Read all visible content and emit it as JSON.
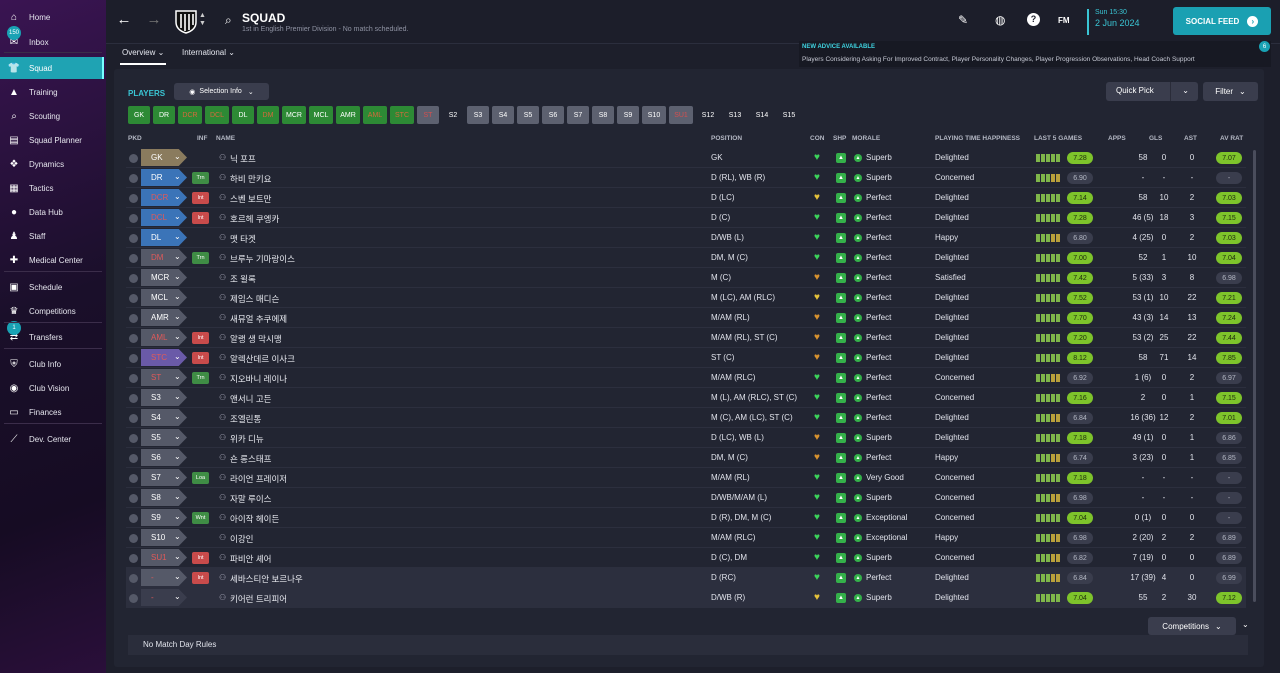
{
  "sidebar": {
    "items": [
      {
        "label": "Home",
        "icon": "home-icon",
        "glyph": "⌂"
      },
      {
        "label": "Inbox",
        "icon": "inbox-icon",
        "glyph": "✉",
        "badge": "150"
      },
      {
        "label": "Squad",
        "icon": "squad-icon",
        "glyph": "👕",
        "active": true
      },
      {
        "label": "Training",
        "icon": "training-icon",
        "glyph": "▲"
      },
      {
        "label": "Scouting",
        "icon": "scouting-icon",
        "glyph": "⌕"
      },
      {
        "label": "Squad Planner",
        "icon": "squad-planner-icon",
        "glyph": "▤"
      },
      {
        "label": "Dynamics",
        "icon": "dynamics-icon",
        "glyph": "❖"
      },
      {
        "label": "Tactics",
        "icon": "tactics-icon",
        "glyph": "▦"
      },
      {
        "label": "Data Hub",
        "icon": "data-hub-icon",
        "glyph": "●"
      },
      {
        "label": "Staff",
        "icon": "staff-icon",
        "glyph": "♟"
      },
      {
        "label": "Medical Center",
        "icon": "medical-icon",
        "glyph": "✚"
      },
      {
        "label": "Schedule",
        "icon": "schedule-icon",
        "glyph": "▣"
      },
      {
        "label": "Competitions",
        "icon": "trophy-icon",
        "glyph": "♛"
      },
      {
        "label": "Transfers",
        "icon": "transfers-icon",
        "glyph": "⇄",
        "badge": "1"
      },
      {
        "label": "Club Info",
        "icon": "club-info-icon",
        "glyph": "⛨"
      },
      {
        "label": "Club Vision",
        "icon": "club-vision-icon",
        "glyph": "◉"
      },
      {
        "label": "Finances",
        "icon": "finances-icon",
        "glyph": "▭"
      },
      {
        "label": "Dev. Center",
        "icon": "dev-center-icon",
        "glyph": "⟋"
      }
    ]
  },
  "header": {
    "title": "SQUAD",
    "subtitle": "1st in English Premier Division - No match scheduled.",
    "date_time": "Sun 15:30",
    "date_day": "2 Jun 2024",
    "fm_label": "FM",
    "social_label": "SOCIAL FEED",
    "social_badge": "6"
  },
  "tabs": {
    "overview": "Overview",
    "international": "International"
  },
  "advice": {
    "title": "NEW ADVICE AVAILABLE",
    "text": "Players Considering Asking For Improved Contract, Player Personality Changes, Player Progression Observations, Head Coach Support"
  },
  "toolbar": {
    "players_label": "PLAYERS",
    "selection_info": "Selection Info",
    "quick_pick": "Quick Pick",
    "filter": "Filter"
  },
  "chips": [
    {
      "label": "GK",
      "style": "g"
    },
    {
      "label": "DR",
      "style": "g"
    },
    {
      "label": "DCR",
      "style": "r"
    },
    {
      "label": "DCL",
      "style": "r"
    },
    {
      "label": "DL",
      "style": "g"
    },
    {
      "label": "DM",
      "style": "r"
    },
    {
      "label": "MCR",
      "style": "g"
    },
    {
      "label": "MCL",
      "style": "g"
    },
    {
      "label": "AMR",
      "style": "g"
    },
    {
      "label": "AML",
      "style": "r"
    },
    {
      "label": "STC",
      "style": "r"
    },
    {
      "label": "ST",
      "style": "gr"
    },
    {
      "label": "S2",
      "style": "k"
    },
    {
      "label": "S3",
      "style": "s"
    },
    {
      "label": "S4",
      "style": "s"
    },
    {
      "label": "S5",
      "style": "s"
    },
    {
      "label": "S6",
      "style": "s"
    },
    {
      "label": "S7",
      "style": "s"
    },
    {
      "label": "S8",
      "style": "s"
    },
    {
      "label": "S9",
      "style": "s"
    },
    {
      "label": "S10",
      "style": "s"
    },
    {
      "label": "SU1",
      "style": "gr"
    },
    {
      "label": "S12",
      "style": "k"
    },
    {
      "label": "S13",
      "style": "k"
    },
    {
      "label": "S14",
      "style": "k"
    },
    {
      "label": "S15",
      "style": "k"
    }
  ],
  "columns": {
    "pkd": "PKD",
    "inf": "INF",
    "name": "NAME",
    "position": "POSITION",
    "con": "CON",
    "shp": "SHP",
    "morale": "MORALE",
    "happiness": "PLAYING TIME HAPPINESS",
    "last5": "LAST 5 GAMES",
    "apps": "APPS",
    "gls": "GLS",
    "ast": "AST",
    "avrat": "AV RAT"
  },
  "colors": {
    "pos_gk": "#8a7b5e",
    "pos_def": "#3b74b8",
    "pos_mid": "#555968",
    "pos_red": "#c84b4b"
  },
  "players": [
    {
      "pos": "GK",
      "pc": "gk",
      "inf": "",
      "name": "닉 포프",
      "position": "GK",
      "con": "green",
      "morale": "Superb",
      "happy": "Delighted",
      "last5": "7.28",
      "l5g": true,
      "apps": "58",
      "gls": "0",
      "ast": "0",
      "avr": "7.07",
      "ag": true
    },
    {
      "pos": "DR",
      "pc": "def",
      "inf": "Trn",
      "name": "하비 만키요",
      "position": "D (RL), WB (R)",
      "con": "green",
      "morale": "Superb",
      "happy": "Concerned",
      "last5": "6.90",
      "l5g": false,
      "apps": "-",
      "gls": "-",
      "ast": "-",
      "avr": "-",
      "ag": false
    },
    {
      "pos": "DCR",
      "pc": "defr",
      "inf": "Int",
      "name": "스벤 보트만",
      "position": "D (LC)",
      "con": "yellow",
      "morale": "Perfect",
      "happy": "Delighted",
      "last5": "7.14",
      "l5g": true,
      "apps": "58",
      "gls": "10",
      "ast": "2",
      "avr": "7.03",
      "ag": true
    },
    {
      "pos": "DCL",
      "pc": "defr",
      "inf": "Int",
      "name": "호르헤 쿠엥카",
      "position": "D (C)",
      "con": "green",
      "morale": "Perfect",
      "happy": "Delighted",
      "last5": "7.28",
      "l5g": true,
      "apps": "46 (5)",
      "gls": "18",
      "ast": "3",
      "avr": "7.15",
      "ag": true
    },
    {
      "pos": "DL",
      "pc": "def",
      "inf": "",
      "name": "맷 타겟",
      "position": "D/WB (L)",
      "con": "green",
      "morale": "Perfect",
      "happy": "Happy",
      "last5": "6.80",
      "l5g": false,
      "apps": "4 (25)",
      "gls": "0",
      "ast": "2",
      "avr": "7.03",
      "ag": true
    },
    {
      "pos": "DM",
      "pc": "midr",
      "inf": "Trn",
      "name": "브루누 기마랑이스",
      "position": "DM, M (C)",
      "con": "green",
      "morale": "Perfect",
      "happy": "Delighted",
      "last5": "7.00",
      "l5g": true,
      "apps": "52",
      "gls": "1",
      "ast": "10",
      "avr": "7.04",
      "ag": true
    },
    {
      "pos": "MCR",
      "pc": "mid",
      "inf": "",
      "name": "조 윌록",
      "position": "M (C)",
      "con": "orange",
      "morale": "Perfect",
      "happy": "Satisfied",
      "last5": "7.42",
      "l5g": true,
      "apps": "5 (33)",
      "gls": "3",
      "ast": "8",
      "avr": "6.98",
      "ag": false
    },
    {
      "pos": "MCL",
      "pc": "mid",
      "inf": "",
      "name": "제임스 매디슨",
      "position": "M (LC), AM (RLC)",
      "con": "yellow",
      "morale": "Perfect",
      "happy": "Delighted",
      "last5": "7.52",
      "l5g": true,
      "apps": "53 (1)",
      "gls": "10",
      "ast": "22",
      "avr": "7.21",
      "ag": true
    },
    {
      "pos": "AMR",
      "pc": "mid",
      "inf": "",
      "name": "새뮤얼 추쿠에제",
      "position": "M/AM (RL)",
      "con": "orange",
      "morale": "Perfect",
      "happy": "Delighted",
      "last5": "7.70",
      "l5g": true,
      "apps": "43 (3)",
      "gls": "14",
      "ast": "13",
      "avr": "7.24",
      "ag": true
    },
    {
      "pos": "AML",
      "pc": "midr",
      "inf": "Int",
      "name": "알랭 생 막시맹",
      "position": "M/AM (RL), ST (C)",
      "con": "orange",
      "morale": "Perfect",
      "happy": "Delighted",
      "last5": "7.20",
      "l5g": true,
      "apps": "53 (2)",
      "gls": "25",
      "ast": "22",
      "avr": "7.44",
      "ag": true
    },
    {
      "pos": "STC",
      "pc": "str",
      "inf": "Int",
      "name": "알렉산데르 이사크",
      "position": "ST (C)",
      "con": "orange",
      "morale": "Perfect",
      "happy": "Delighted",
      "last5": "8.12",
      "l5g": true,
      "apps": "58",
      "gls": "71",
      "ast": "14",
      "avr": "7.85",
      "ag": true
    },
    {
      "pos": "ST",
      "pc": "midr",
      "inf": "Trn",
      "name": "지오바니 레이나",
      "position": "M/AM (RLC)",
      "con": "green",
      "morale": "Perfect",
      "happy": "Concerned",
      "last5": "6.92",
      "l5g": false,
      "apps": "1 (6)",
      "gls": "0",
      "ast": "2",
      "avr": "6.97",
      "ag": false
    },
    {
      "pos": "S3",
      "pc": "mid",
      "inf": "",
      "name": "앤서니 고든",
      "position": "M (L), AM (RLC), ST (C)",
      "con": "green",
      "morale": "Perfect",
      "happy": "Concerned",
      "last5": "7.16",
      "l5g": true,
      "apps": "2",
      "gls": "0",
      "ast": "1",
      "avr": "7.15",
      "ag": true
    },
    {
      "pos": "S4",
      "pc": "mid",
      "inf": "",
      "name": "조엘린통",
      "position": "M (C), AM (LC), ST (C)",
      "con": "green",
      "morale": "Perfect",
      "happy": "Delighted",
      "last5": "6.84",
      "l5g": false,
      "apps": "16 (36)",
      "gls": "12",
      "ast": "2",
      "avr": "7.01",
      "ag": true
    },
    {
      "pos": "S5",
      "pc": "mid",
      "inf": "",
      "name": "위카 디뉴",
      "position": "D (LC), WB (L)",
      "con": "orange",
      "morale": "Superb",
      "happy": "Delighted",
      "last5": "7.18",
      "l5g": true,
      "apps": "49 (1)",
      "gls": "0",
      "ast": "1",
      "avr": "6.86",
      "ag": false
    },
    {
      "pos": "S6",
      "pc": "mid",
      "inf": "",
      "name": "숀 롱스태프",
      "position": "DM, M (C)",
      "con": "orange",
      "morale": "Perfect",
      "happy": "Happy",
      "last5": "6.74",
      "l5g": false,
      "apps": "3 (23)",
      "gls": "0",
      "ast": "1",
      "avr": "6.85",
      "ag": false
    },
    {
      "pos": "S7",
      "pc": "mid",
      "inf": "Loa",
      "name": "라이언 프레이저",
      "position": "M/AM (RL)",
      "con": "green",
      "morale": "Very Good",
      "happy": "Concerned",
      "last5": "7.18",
      "l5g": true,
      "apps": "-",
      "gls": "-",
      "ast": "-",
      "avr": "-",
      "ag": false
    },
    {
      "pos": "S8",
      "pc": "mid",
      "inf": "",
      "name": "자말 루이스",
      "position": "D/WB/M/AM (L)",
      "con": "green",
      "morale": "Superb",
      "happy": "Concerned",
      "last5": "6.98",
      "l5g": false,
      "apps": "-",
      "gls": "-",
      "ast": "-",
      "avr": "-",
      "ag": false
    },
    {
      "pos": "S9",
      "pc": "mid",
      "inf": "Wnt",
      "name": "아이작 헤이든",
      "position": "D (R), DM, M (C)",
      "con": "green",
      "morale": "Exceptional",
      "happy": "Concerned",
      "last5": "7.04",
      "l5g": true,
      "apps": "0 (1)",
      "gls": "0",
      "ast": "0",
      "avr": "-",
      "ag": false
    },
    {
      "pos": "S10",
      "pc": "mid",
      "inf": "",
      "name": "이강인",
      "position": "M/AM (RLC)",
      "con": "green",
      "morale": "Exceptional",
      "happy": "Happy",
      "last5": "6.98",
      "l5g": false,
      "apps": "2 (20)",
      "gls": "2",
      "ast": "2",
      "avr": "6.89",
      "ag": false
    },
    {
      "pos": "SU1",
      "pc": "midr",
      "inf": "Int",
      "name": "파비안 셰어",
      "position": "D (C), DM",
      "con": "green",
      "morale": "Superb",
      "happy": "Concerned",
      "last5": "6.82",
      "l5g": false,
      "apps": "7 (19)",
      "gls": "0",
      "ast": "0",
      "avr": "6.89",
      "ag": false
    },
    {
      "pos": "-",
      "pc": "midr",
      "inf": "Int",
      "name": "세바스티안 보르나우",
      "position": "D (RC)",
      "con": "green",
      "morale": "Perfect",
      "happy": "Delighted",
      "last5": "6.84",
      "l5g": false,
      "apps": "17 (39)",
      "gls": "4",
      "ast": "0",
      "avr": "6.99",
      "ag": false,
      "hl": true
    },
    {
      "pos": "-",
      "pc": "none",
      "inf": "",
      "name": "키어런 트리피어",
      "position": "D/WB (R)",
      "con": "yellow",
      "morale": "Superb",
      "happy": "Delighted",
      "last5": "7.04",
      "l5g": true,
      "apps": "55",
      "gls": "2",
      "ast": "30",
      "avr": "7.12",
      "ag": true,
      "hl": true
    }
  ],
  "footer": {
    "no_match": "No Match Day Rules",
    "competitions": "Competitions"
  }
}
